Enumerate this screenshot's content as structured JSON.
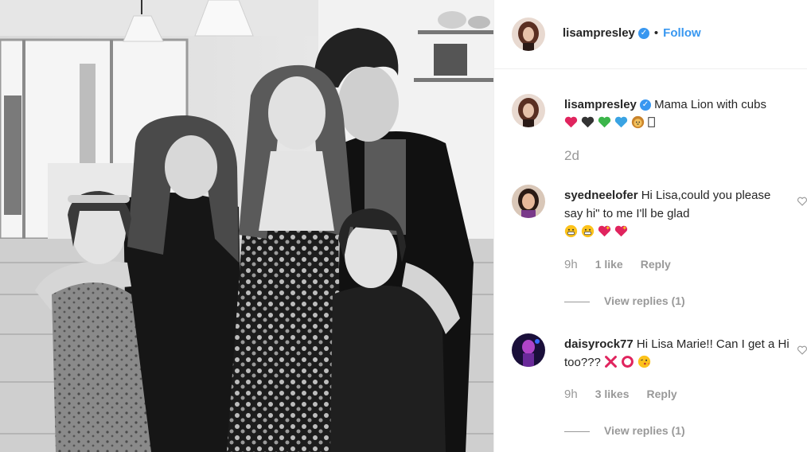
{
  "post": {
    "author": "lisampresley",
    "follow_label": "Follow",
    "separator": "•",
    "caption_author": "lisampresley",
    "caption_text": "Mama Lion with cubs",
    "caption_emojis": [
      "red-heart",
      "black-heart",
      "green-heart",
      "blue-heart",
      "lion-face",
      "unknown-glyph"
    ],
    "timestamp": "2d"
  },
  "comments": [
    {
      "author": "syedneelofer",
      "text": "Hi Lisa,could you please say hi\" to me I'll be glad",
      "emojis": [
        "grinning-face",
        "grinning-face",
        "sparkling-heart",
        "sparkling-heart"
      ],
      "time": "9h",
      "likes": "1 like",
      "reply_label": "Reply",
      "view_replies": "View replies (1)"
    },
    {
      "author": "daisyrock77",
      "text": "Hi Lisa Marie!! Can I get a Hi too???",
      "emojis": [
        "cross-mark",
        "hollow-red-circle",
        "kissing-face"
      ],
      "time": "9h",
      "likes": "3 likes",
      "reply_label": "Reply",
      "view_replies": "View replies (1)"
    }
  ],
  "colors": {
    "link_blue": "#3897f0",
    "text": "#262626",
    "muted": "#999999"
  }
}
